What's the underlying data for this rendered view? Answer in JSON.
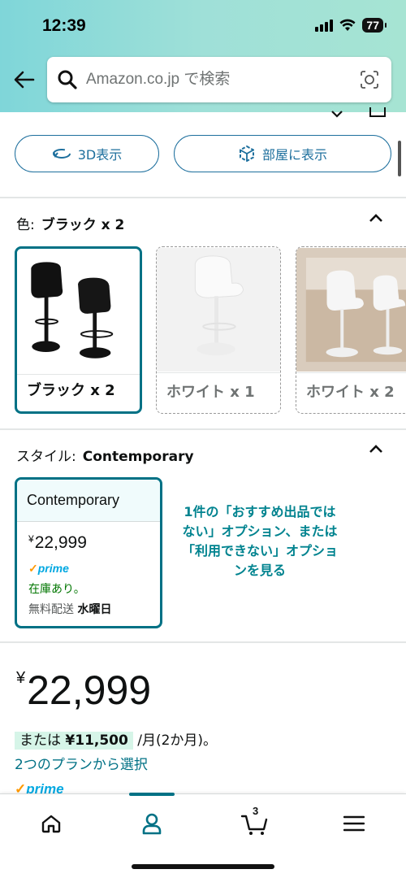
{
  "status_bar": {
    "time": "12:39",
    "battery": "77"
  },
  "search": {
    "placeholder": "Amazon.co.jp で検索"
  },
  "view_buttons": {
    "view_3d": "3D表示",
    "view_in_room": "部屋に表示"
  },
  "color_section": {
    "label": "色:",
    "selected_value": "ブラック x 2",
    "options": [
      {
        "label": "ブラック x 2",
        "selected": true,
        "available": true
      },
      {
        "label": "ホワイト x 1",
        "selected": false,
        "available": false
      },
      {
        "label": "ホワイト x 2",
        "selected": false,
        "available": false
      }
    ]
  },
  "style_section": {
    "label": "スタイル:",
    "selected_value": "Contemporary",
    "card": {
      "title": "Contemporary",
      "currency": "¥",
      "price": "22,999",
      "prime": "prime",
      "stock": "在庫あり。",
      "shipping_prefix": "無料配送",
      "shipping_day": "水曜日"
    },
    "unavailable_link": "1件の「おすすめ出品ではない」オプション、または「利用できない」オプションを見る"
  },
  "price_block": {
    "currency": "¥",
    "price": "22,999",
    "installment_prefix": "または",
    "installment_amount": "¥11,500",
    "installment_suffix": "/月(2か月)。",
    "plans_link": "2つのプランから選択",
    "prime": "prime"
  },
  "bottom_nav": {
    "cart_count": "3",
    "active": "account"
  },
  "colors": {
    "teal_accent": "#007185",
    "link_blue": "#1d6f9d",
    "stock_green": "#007600",
    "prime_blue": "#00a8e1",
    "prime_orange": "#ff9900",
    "header_teal": "#7fd6d9"
  }
}
